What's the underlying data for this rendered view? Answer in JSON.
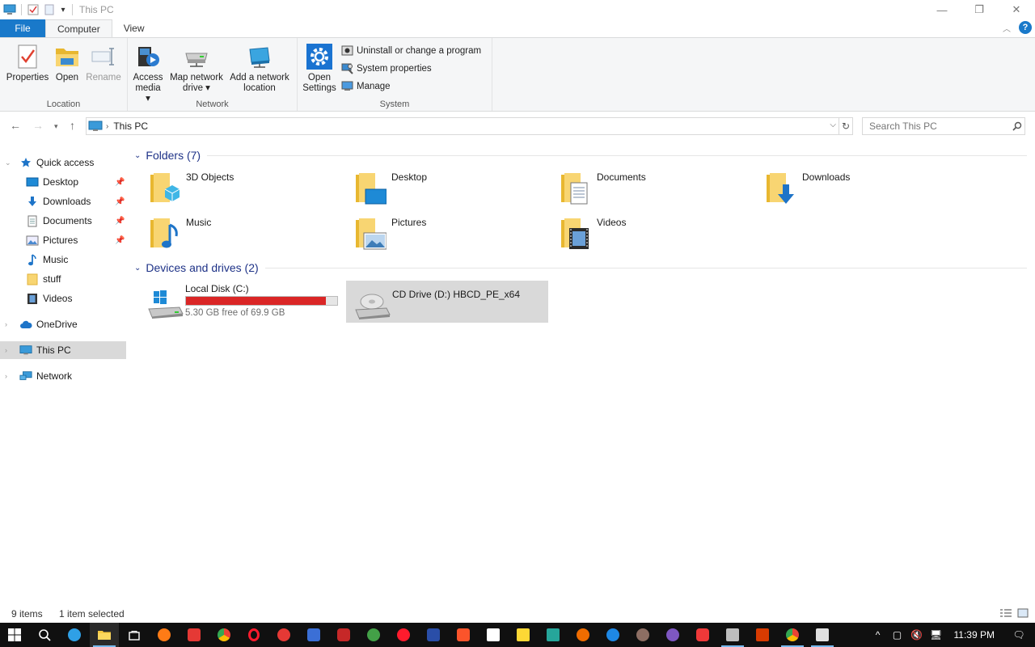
{
  "window": {
    "title": "This PC",
    "controls": {
      "minimize": "—",
      "restore": "❐",
      "close": "✕"
    },
    "quick_access_dropdown": "▾"
  },
  "tabs": [
    {
      "label": "File"
    },
    {
      "label": "Computer"
    },
    {
      "label": "View"
    }
  ],
  "ribbon": {
    "location": {
      "label": "Location",
      "properties": "Properties",
      "open": "Open",
      "rename": "Rename"
    },
    "network": {
      "label": "Network",
      "access_media_1": "Access",
      "access_media_2": "media ▾",
      "map_drive_1": "Map network",
      "map_drive_2": "drive ▾",
      "add_location_1": "Add a network",
      "add_location_2": "location"
    },
    "system": {
      "label": "System",
      "open_settings_1": "Open",
      "open_settings_2": "Settings",
      "uninstall": "Uninstall or change a program",
      "system_properties": "System properties",
      "manage": "Manage"
    }
  },
  "address": {
    "path": "This PC",
    "search_placeholder": "Search This PC"
  },
  "nav": {
    "quick_access": "Quick access",
    "items": [
      {
        "label": "Desktop",
        "pinned": true
      },
      {
        "label": "Downloads",
        "pinned": true
      },
      {
        "label": "Documents",
        "pinned": true
      },
      {
        "label": "Pictures",
        "pinned": true
      },
      {
        "label": "Music",
        "pinned": false
      },
      {
        "label": "stuff",
        "pinned": false
      },
      {
        "label": "Videos",
        "pinned": false
      }
    ],
    "onedrive": "OneDrive",
    "this_pc": "This PC",
    "network": "Network"
  },
  "content": {
    "folders_heading": "Folders (7)",
    "folders": [
      {
        "name": "3D Objects"
      },
      {
        "name": "Desktop"
      },
      {
        "name": "Documents"
      },
      {
        "name": "Downloads"
      },
      {
        "name": "Music"
      },
      {
        "name": "Pictures"
      },
      {
        "name": "Videos"
      }
    ],
    "drives_heading": "Devices and drives (2)",
    "drives": [
      {
        "name": "Local Disk (C:)",
        "free": "5.30 GB free of 69.9 GB",
        "used_fraction": 0.924
      },
      {
        "name": "CD Drive (D:) HBCD_PE_x64"
      }
    ]
  },
  "status": {
    "items": "9 items",
    "selected": "1 item selected"
  },
  "taskbar": {
    "clock": "11:39 PM",
    "tray_chevron": "^"
  },
  "colors": {
    "accent": "#1979ca",
    "section_heading": "#1e3287",
    "selection": "#d9d9d9",
    "drive_bar": "#da2626",
    "taskbar": "#101010"
  }
}
